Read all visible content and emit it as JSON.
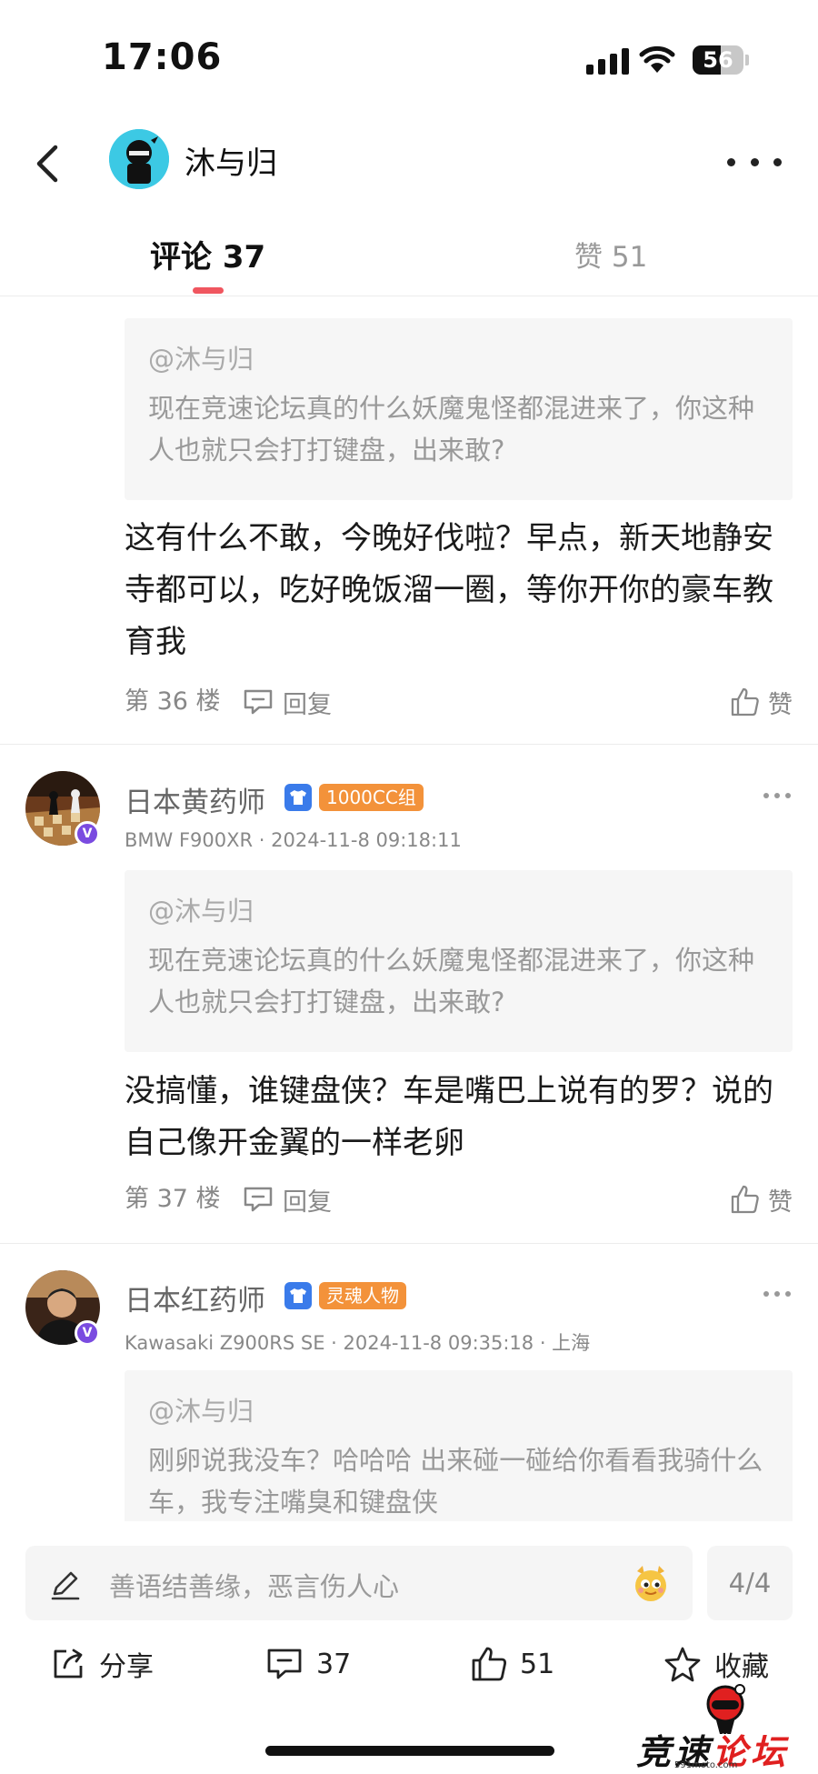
{
  "status_bar": {
    "time": "17:06",
    "battery": "56",
    "battery_level": 0.56
  },
  "header": {
    "user_name": "沐与归"
  },
  "tabs": {
    "comments_label": "评论 37",
    "likes_label": "赞 51"
  },
  "comments": [
    {
      "quote_author": "@沐与归",
      "quote_text": "现在竞速论坛真的什么妖魔鬼怪都混进来了，你这种人也就只会打打键盘，出来敢?",
      "reply_text": "这有什么不敢，今晚好伐啦？早点，新天地静安寺都可以，吃好晚饭溜一圈，等你开你的豪车教育我",
      "floor": "第 36 楼",
      "reply_label": "回复",
      "like_label": "赞"
    },
    {
      "name": "日本黄药师",
      "badge": "1000CC组",
      "meta": "BMW F900XR · 2024-11-8 09:18:11",
      "quote_author": "@沐与归",
      "quote_text": "现在竞速论坛真的什么妖魔鬼怪都混进来了，你这种人也就只会打打键盘，出来敢?",
      "reply_text": "没搞懂，谁键盘侠？车是嘴巴上说有的罗？说的自己像开金翼的一样老卵",
      "floor": "第 37 楼",
      "reply_label": "回复",
      "like_label": "赞"
    },
    {
      "name": "日本红药师",
      "badge": "灵魂人物",
      "meta": "Kawasaki Z900RS SE · 2024-11-8 09:35:18 · 上海",
      "quote_author": "@沐与归",
      "quote_text": "刚卵说我没车？哈哈哈 出来碰一碰给你看看我骑什么车，我专注嘴臭和键盘侠"
    }
  ],
  "input": {
    "placeholder": "善语结善缘，恶言伤人心",
    "page_counter": "4/4"
  },
  "action_bar": {
    "share": "分享",
    "comments": "37",
    "likes": "51",
    "favorite": "收藏"
  },
  "watermark": {
    "part1": "竞速",
    "part2": "论坛",
    "url": "591moto.com"
  }
}
